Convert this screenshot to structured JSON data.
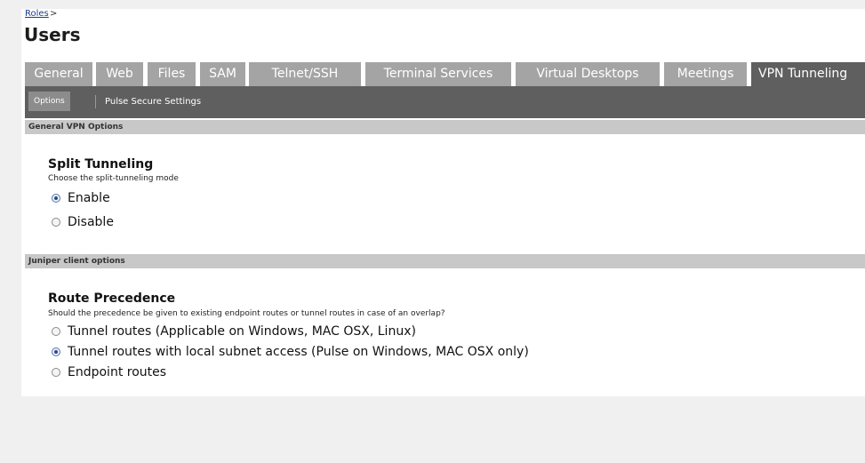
{
  "breadcrumb": {
    "link": "Roles",
    "separator": ">"
  },
  "page_title": "Users",
  "tabs": [
    {
      "label": "General"
    },
    {
      "label": "Web"
    },
    {
      "label": "Files"
    },
    {
      "label": "SAM"
    },
    {
      "label": "Telnet/SSH"
    },
    {
      "label": "Terminal Services"
    },
    {
      "label": "Virtual Desktops"
    },
    {
      "label": "Meetings"
    },
    {
      "label": "VPN Tunneling",
      "active": true
    }
  ],
  "subnav": {
    "options": "Options",
    "pulse": "Pulse Secure Settings"
  },
  "sections": {
    "general": {
      "header": "General VPN Options",
      "title": "Split Tunneling",
      "desc": "Choose the split-tunneling mode",
      "options": [
        {
          "label": "Enable",
          "checked": true
        },
        {
          "label": "Disable",
          "checked": false
        }
      ]
    },
    "juniper": {
      "header": "Juniper client options",
      "title": "Route Precedence",
      "desc": "Should the precedence be given to existing endpoint routes or tunnel routes in case of an overlap?",
      "options": [
        {
          "label": "Tunnel routes (Applicable on Windows, MAC OSX, Linux)",
          "checked": false
        },
        {
          "label": "Tunnel routes with local subnet access (Pulse on Windows, MAC OSX only)",
          "checked": true
        },
        {
          "label": "Endpoint routes",
          "checked": false
        }
      ]
    }
  }
}
